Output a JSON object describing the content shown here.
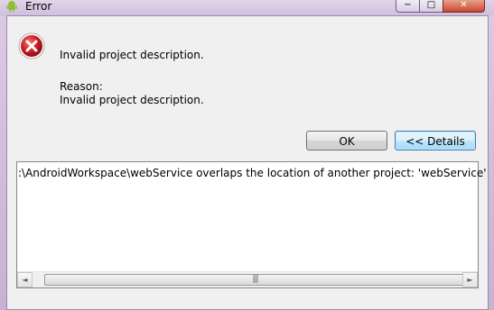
{
  "window": {
    "title": "Error",
    "controls": {
      "minimize": "−",
      "maximize": "□",
      "close": "✕"
    }
  },
  "dialog": {
    "message": "Invalid project description.",
    "reason_label": "Reason:",
    "reason_text": "Invalid project description.",
    "icon": "error-icon"
  },
  "buttons": {
    "ok": "OK",
    "details": "<< Details"
  },
  "details": {
    "text": ":\\AndroidWorkspace\\webService overlaps the location of another project: 'webService'",
    "scrollbar": {
      "left_arrow": "◄",
      "right_arrow": "►",
      "grip": "|||"
    }
  },
  "colors": {
    "error_red": "#d4202a",
    "focus_blue": "#3c7fb1"
  }
}
